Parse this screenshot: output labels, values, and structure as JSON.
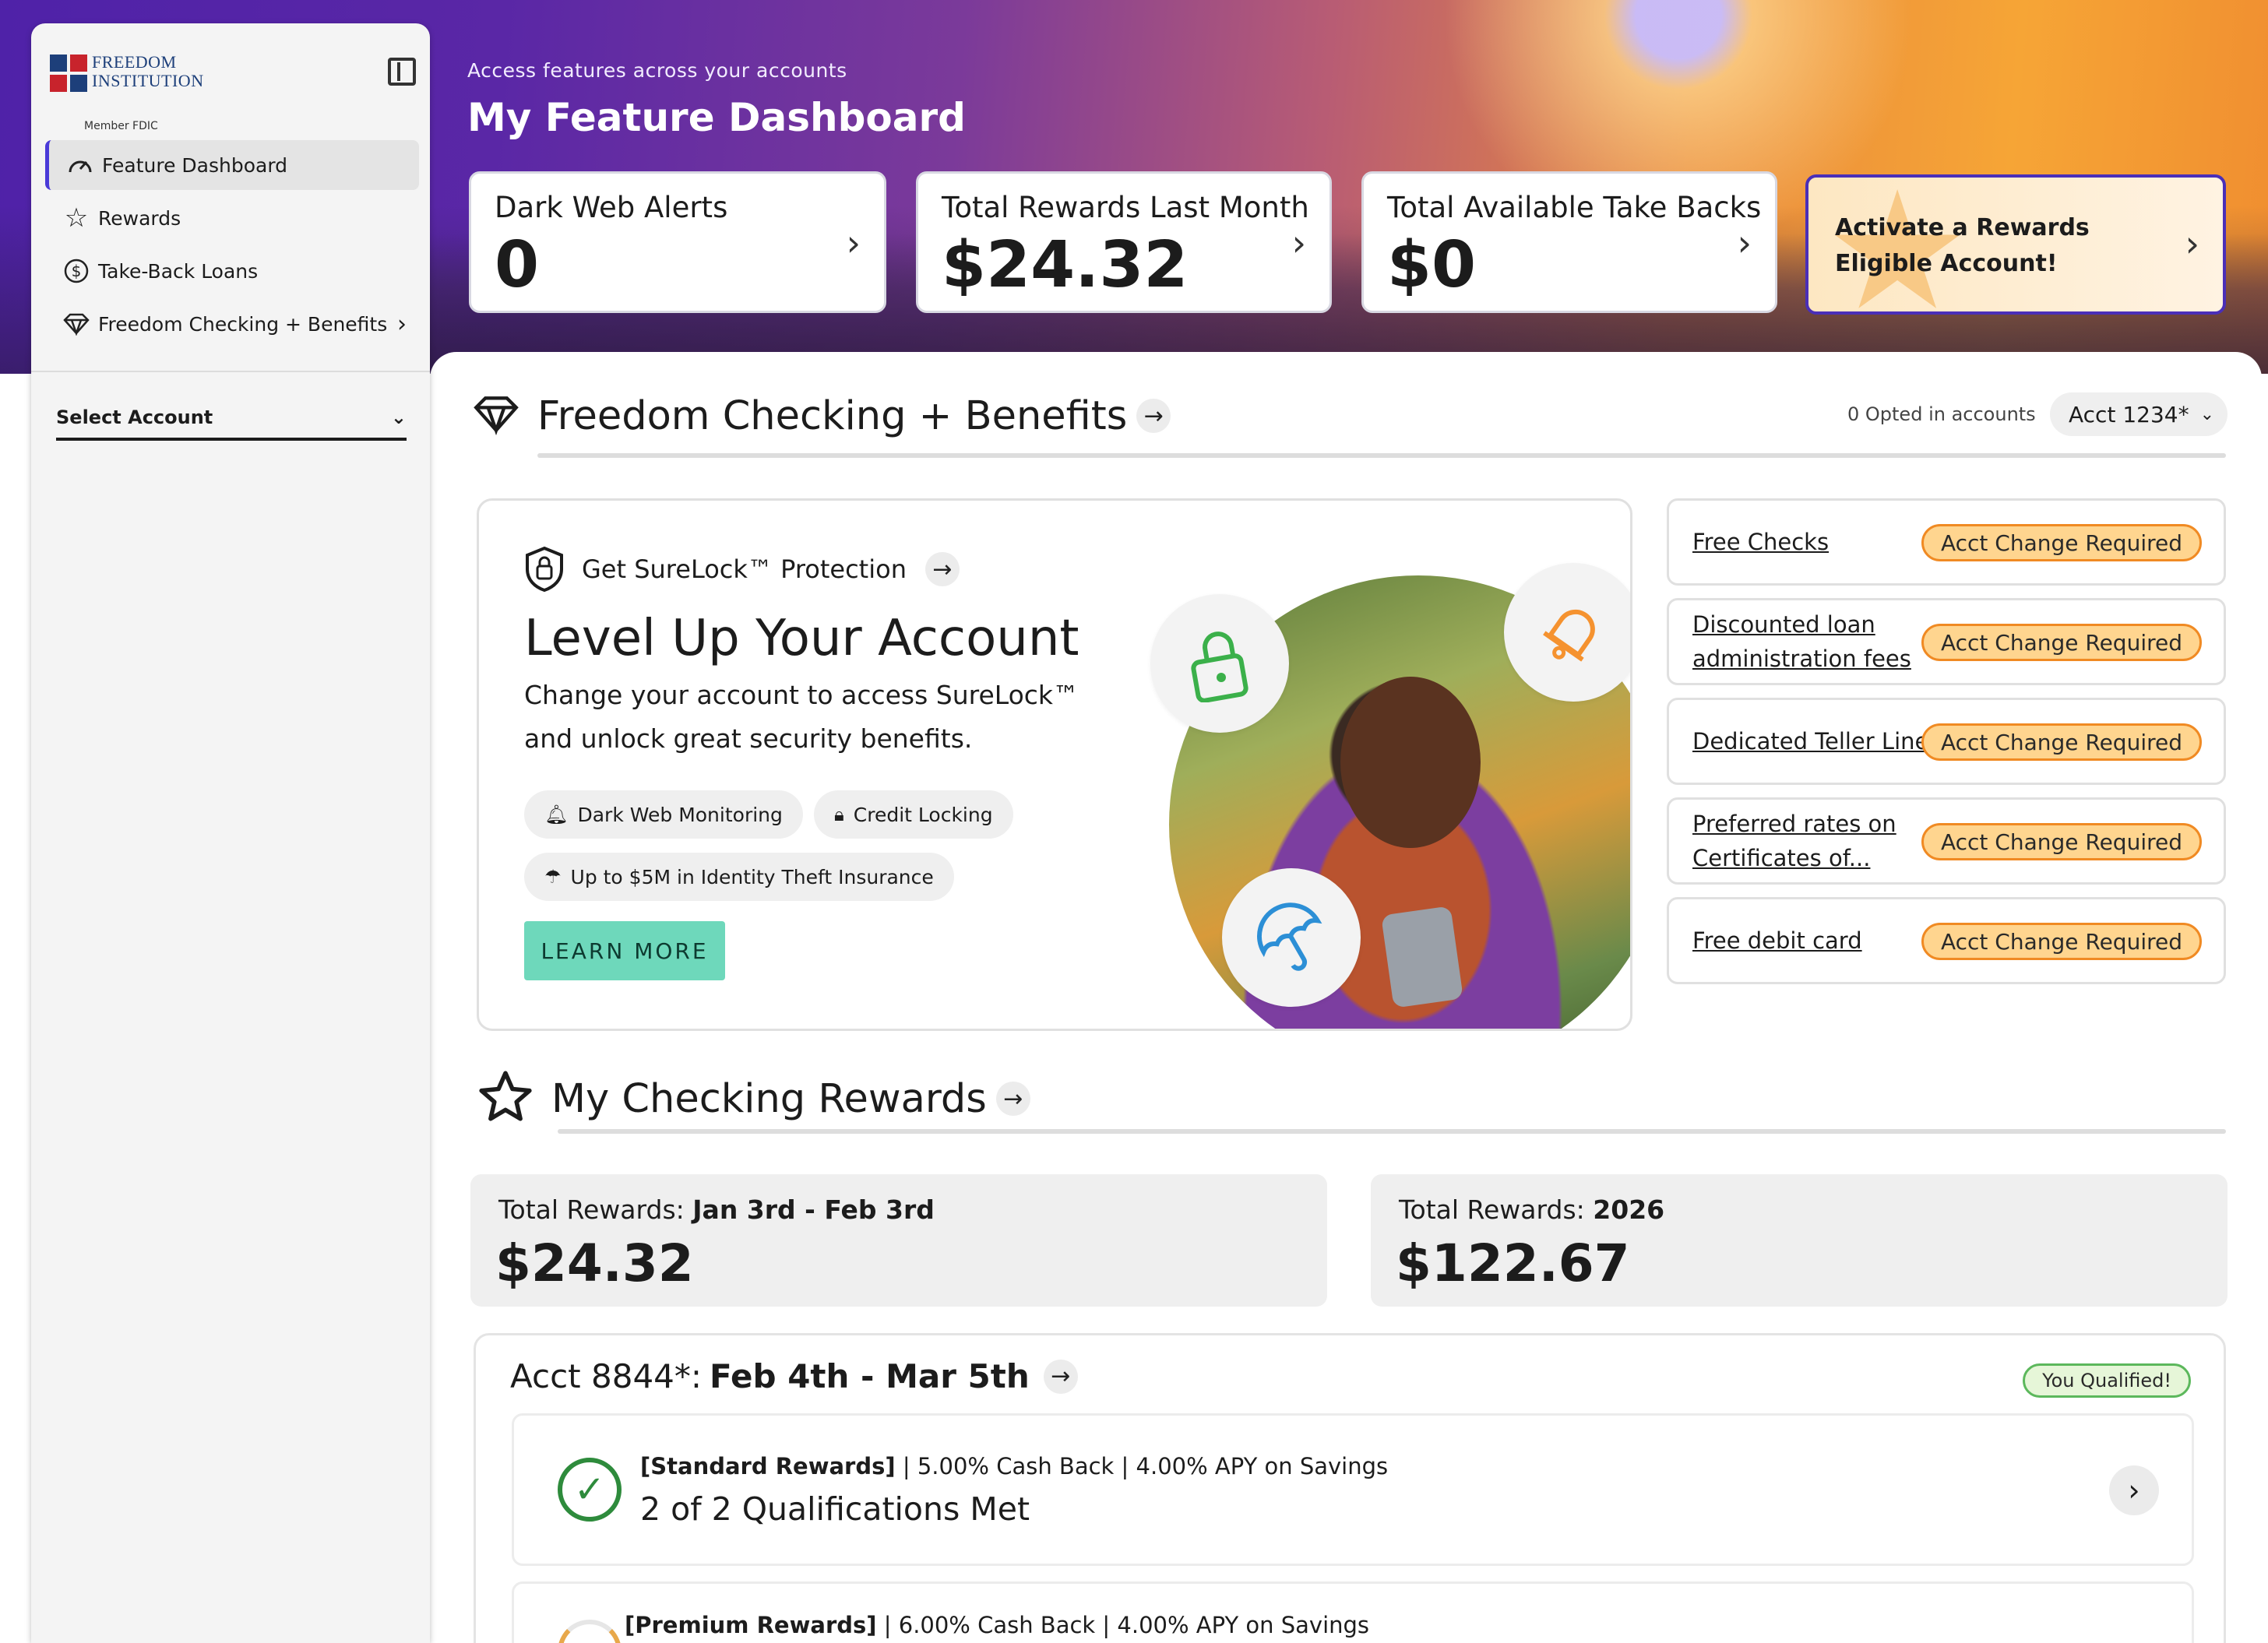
{
  "sidebar": {
    "logo_line1": "FREEDOM",
    "logo_line2": "INSTITUTION",
    "logo_member": "Member FDIC",
    "items": [
      {
        "label": "Feature Dashboard",
        "icon": "gauge-icon"
      },
      {
        "label": "Rewards",
        "icon": "star-icon"
      },
      {
        "label": "Take-Back Loans",
        "icon": "dollar-cycle-icon"
      },
      {
        "label": "Freedom Checking + Benefits",
        "icon": "diamond-icon"
      }
    ],
    "select_account": "Select Account"
  },
  "hero": {
    "subtitle": "Access features across your accounts",
    "title": "My Feature Dashboard",
    "cards": [
      {
        "label": "Dark Web Alerts",
        "value": "0"
      },
      {
        "label": "Total Rewards Last Month",
        "value": "$24.32"
      },
      {
        "label": "Total Available Take Backs",
        "value": "$0"
      }
    ],
    "promo": "Activate a Rewards Eligible Account!"
  },
  "benefits_section": {
    "title": "Freedom Checking + Benefits",
    "opted": "0 Opted in accounts",
    "account": "Acct 1234*",
    "surelock": "Get SureLock™ Protection",
    "headline": "Level Up Your Account",
    "desc": "Change your account to access SureLock™ and unlock great security benefits.",
    "pills": [
      "Dark Web Monitoring",
      "Credit Locking",
      "Up to $5M in Identity Theft Insurance"
    ],
    "cta": "LEARN MORE",
    "benefits": [
      {
        "label": "Free Checks",
        "badge": "Acct Change Required"
      },
      {
        "label": "Discounted loan administration fees",
        "badge": "Acct Change Required"
      },
      {
        "label": "Dedicated Teller Line",
        "badge": "Acct Change Required"
      },
      {
        "label": "Preferred rates on Certificates of...",
        "badge": "Acct Change Required"
      },
      {
        "label": "Free debit card",
        "badge": "Acct Change Required"
      }
    ]
  },
  "rewards_section": {
    "title": "My Checking Rewards",
    "card1_prefix": "Total Rewards: ",
    "card1_range": "Jan 3rd - Feb 3rd",
    "card1_value": "$24.32",
    "card2_prefix": "Total Rewards: ",
    "card2_range": "2026",
    "card2_value": "$122.67",
    "acct_label": "Acct 8844*:",
    "acct_range": "Feb 4th - Mar 5th",
    "qualified": "You Qualified!",
    "standard_tier": "[Standard Rewards]",
    "standard_terms": " | 5.00% Cash Back | 4.00% APY on Savings",
    "standard_status": "2 of 2 Qualifications Met",
    "premium_tier": "[Premium Rewards]",
    "premium_terms": " | 6.00% Cash Back | 4.00% APY on Savings"
  },
  "colors": {
    "accent": "#4a2fb8",
    "badge_fill": "#ffd58f",
    "badge_border": "#f08a23",
    "cta": "#6ed8bb",
    "success": "#2e8b3c"
  }
}
